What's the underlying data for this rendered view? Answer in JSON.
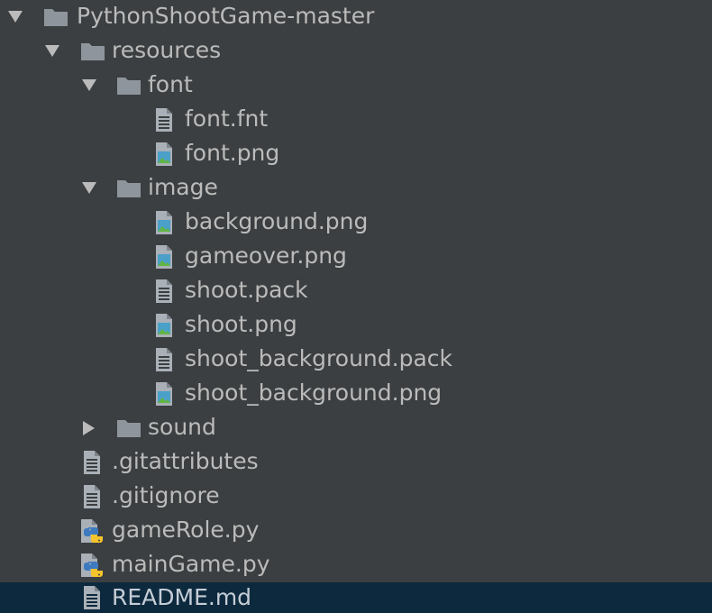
{
  "tree": {
    "items": [
      {
        "label": "PythonShootGame-master",
        "kind": "folder",
        "expanded": true,
        "icon": "folder-icon"
      },
      {
        "label": "resources",
        "kind": "folder",
        "expanded": true,
        "icon": "folder-icon"
      },
      {
        "label": "font",
        "kind": "folder",
        "expanded": true,
        "icon": "folder-icon"
      },
      {
        "label": "font.fnt",
        "kind": "text",
        "icon": "text-file-icon"
      },
      {
        "label": "font.png",
        "kind": "image",
        "icon": "image-file-icon"
      },
      {
        "label": "image",
        "kind": "folder",
        "expanded": true,
        "icon": "folder-icon"
      },
      {
        "label": "background.png",
        "kind": "image",
        "icon": "image-file-icon"
      },
      {
        "label": "gameover.png",
        "kind": "image",
        "icon": "image-file-icon"
      },
      {
        "label": "shoot.pack",
        "kind": "text",
        "icon": "text-file-icon"
      },
      {
        "label": "shoot.png",
        "kind": "image",
        "icon": "image-file-icon"
      },
      {
        "label": "shoot_background.pack",
        "kind": "text",
        "icon": "text-file-icon"
      },
      {
        "label": "shoot_background.png",
        "kind": "image",
        "icon": "image-file-icon"
      },
      {
        "label": "sound",
        "kind": "folder",
        "expanded": false,
        "icon": "folder-icon"
      },
      {
        "label": ".gitattributes",
        "kind": "text",
        "icon": "text-file-icon"
      },
      {
        "label": ".gitignore",
        "kind": "text",
        "icon": "text-file-icon"
      },
      {
        "label": "gameRole.py",
        "kind": "python",
        "icon": "python-file-icon"
      },
      {
        "label": "mainGame.py",
        "kind": "python",
        "icon": "python-file-icon"
      },
      {
        "label": "README.md",
        "kind": "text",
        "icon": "text-file-icon",
        "selected": true
      }
    ]
  },
  "colors": {
    "background": "#3c3f41",
    "selection": "#0d293e",
    "text": "#bbbbbb",
    "folder": "#8e959c",
    "file": "#a9b0b7",
    "image_sky": "#4aa0c8",
    "image_hill": "#62b543",
    "python_blue": "#3e7ac0",
    "python_yellow": "#f5c42c"
  }
}
